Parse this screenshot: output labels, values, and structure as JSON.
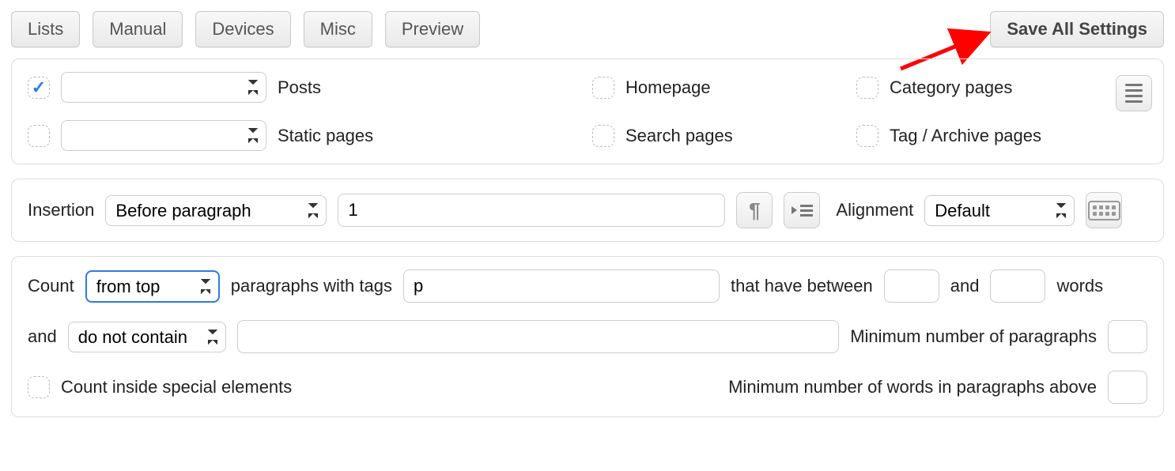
{
  "toolbar": {
    "lists": "Lists",
    "manual": "Manual",
    "devices": "Devices",
    "misc": "Misc",
    "preview": "Preview",
    "save_all": "Save All Settings"
  },
  "placement": {
    "posts_checked": true,
    "posts_label": "Posts",
    "static_pages_checked": false,
    "static_pages_label": "Static pages",
    "homepage_checked": false,
    "homepage_label": "Homepage",
    "search_pages_checked": false,
    "search_pages_label": "Search pages",
    "category_pages_checked": false,
    "category_pages_label": "Category pages",
    "tag_archive_checked": false,
    "tag_archive_label": "Tag / Archive pages",
    "posts_select": "",
    "static_select": ""
  },
  "insertion": {
    "label": "Insertion",
    "mode": "Before paragraph",
    "value": "1",
    "alignment_label": "Alignment",
    "alignment": "Default"
  },
  "count": {
    "label": "Count",
    "direction": "from top",
    "paragraphs_with_tags_label": "paragraphs with tags",
    "tags_value": "p",
    "between_label": "that have between",
    "min_words": "",
    "and_label": "and",
    "max_words": "",
    "words_label": "words",
    "and2_label": "and",
    "contain_mode": "do not contain",
    "contain_value": "",
    "min_paragraphs_label": "Minimum number of paragraphs",
    "min_paragraphs": "",
    "count_inside_checked": false,
    "count_inside_label": "Count inside special elements",
    "min_words_above_label": "Minimum number of words in paragraphs above",
    "min_words_above": ""
  }
}
